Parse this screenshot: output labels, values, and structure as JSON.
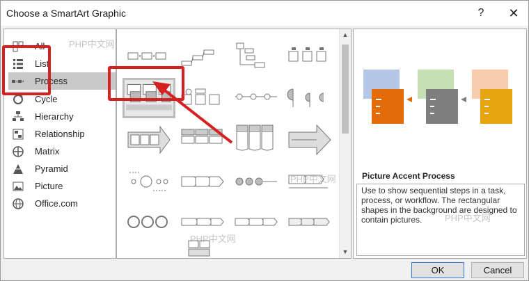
{
  "dialog": {
    "title": "Choose a SmartArt Graphic",
    "help_label": "?",
    "close_label": "✕"
  },
  "categories": [
    {
      "label": "All",
      "icon": "all-icon"
    },
    {
      "label": "List",
      "icon": "list-icon"
    },
    {
      "label": "Process",
      "icon": "process-icon",
      "selected": true
    },
    {
      "label": "Cycle",
      "icon": "cycle-icon"
    },
    {
      "label": "Hierarchy",
      "icon": "hierarchy-icon"
    },
    {
      "label": "Relationship",
      "icon": "relationship-icon"
    },
    {
      "label": "Matrix",
      "icon": "matrix-icon"
    },
    {
      "label": "Pyramid",
      "icon": "pyramid-icon"
    },
    {
      "label": "Picture",
      "icon": "picture-icon"
    },
    {
      "label": "Office.com",
      "icon": "globe-icon"
    }
  ],
  "preview": {
    "name": "Picture Accent Process",
    "description": "Use to show sequential steps in a task, process, or workflow. The rectangular shapes in the background are designed to contain pictures."
  },
  "buttons": {
    "ok": "OK",
    "cancel": "Cancel"
  },
  "watermark": "PHP中文网",
  "colors": {
    "highlight_red": "#d42020",
    "selection_gray": "#c8c8c8",
    "accent_blue": "#4472c4",
    "accent_orange": "#e36c09",
    "accent_gray": "#7f7f7f",
    "accent_gold": "#e7a50f"
  }
}
